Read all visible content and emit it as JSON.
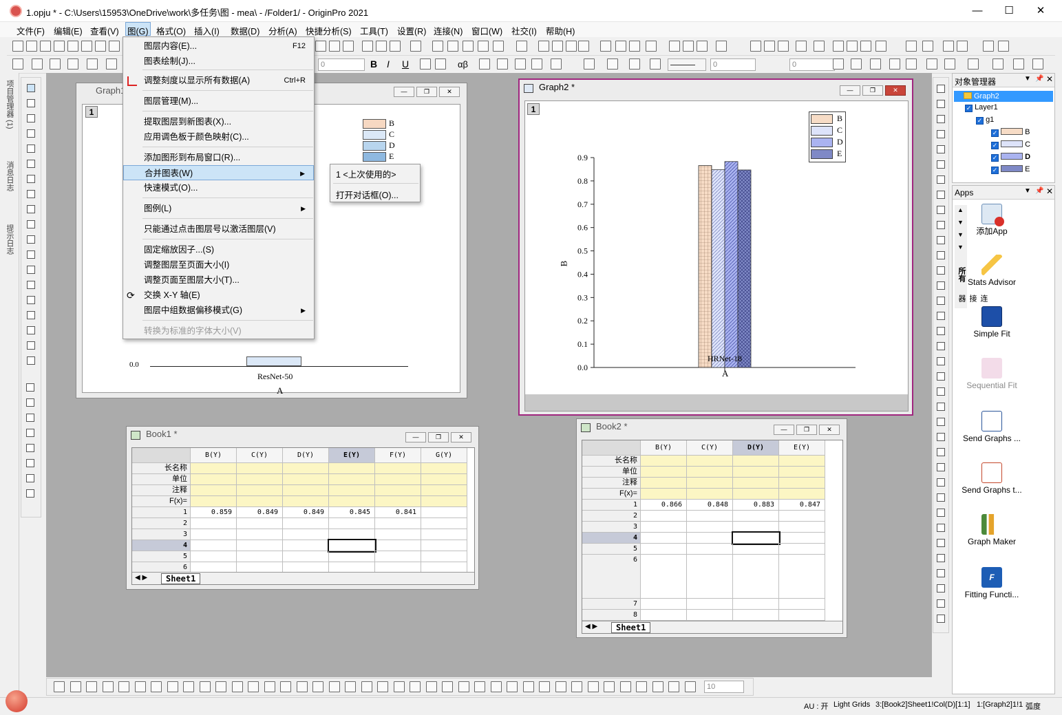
{
  "window": {
    "title": "1.opju * - C:\\Users\\15953\\OneDrive\\work\\多任务\\图 - mea\\ - /Folder1/ - OriginPro 2021",
    "minimize": "—",
    "maximize": "☐",
    "close": "✕"
  },
  "menubar": {
    "items": [
      "文件(F)",
      "编辑(E)",
      "查看(V)",
      "图(G)",
      "格式(O)",
      "插入(I)",
      "数据(D)",
      "分析(A)",
      "快捷分析(S)",
      "工具(T)",
      "设置(R)",
      "连接(N)",
      "窗口(W)",
      "社交(I)",
      "帮助(H)"
    ]
  },
  "toolbar": {
    "font_size_a": "0",
    "font_size_b": "0",
    "font_size_c": "0",
    "line_width": "0",
    "bold": "B",
    "italic": "I",
    "underline": "U",
    "alpha": "αβ",
    "zoom_value": "10"
  },
  "graph_menu": {
    "items": [
      {
        "label": "图层内容(E)...",
        "shortcut": "F12"
      },
      {
        "label": "图表绘制(J)...",
        "shortcut": ""
      },
      {
        "label": "调整刻度以显示所有数据(A)",
        "shortcut": "Ctrl+R"
      },
      {
        "label": "图层管理(M)...",
        "shortcut": ""
      },
      {
        "label": "提取图层到新图表(X)...",
        "shortcut": ""
      },
      {
        "label": "应用调色板于颜色映射(C)...",
        "shortcut": ""
      },
      {
        "label": "添加图形到布局窗口(R)...",
        "shortcut": ""
      },
      {
        "label": "合并图表(W)",
        "shortcut": ""
      },
      {
        "label": "快速模式(O)...",
        "shortcut": ""
      },
      {
        "label": "图例(L)",
        "shortcut": ""
      },
      {
        "label": "只能通过点击图层号以激活图层(V)",
        "shortcut": ""
      },
      {
        "label": "固定缩放因子...(S)",
        "shortcut": ""
      },
      {
        "label": "调整图层至页面大小(I)",
        "shortcut": ""
      },
      {
        "label": "调整页面至图层大小(T)...",
        "shortcut": ""
      },
      {
        "label": "交换 X-Y 轴(E)",
        "shortcut": ""
      },
      {
        "label": "图层中组数据偏移模式(G)",
        "shortcut": ""
      },
      {
        "label": "转换为标准的字体大小(V)",
        "shortcut": ""
      }
    ],
    "submenu": [
      "1 <上次使用的>",
      "打开对话框(O)..."
    ]
  },
  "graph1": {
    "title": "Graph1",
    "layer": "1",
    "legend": [
      "B",
      "C",
      "D",
      "E"
    ],
    "y_tick": "0.0",
    "y_label": "B",
    "x_category": "ResNet-50",
    "x_label": "A"
  },
  "graph2": {
    "title": "Graph2 *",
    "layer": "1",
    "legend": [
      "B",
      "C",
      "D",
      "E"
    ],
    "y_label": "B",
    "x_label": "A"
  },
  "chart_data": {
    "type": "bar",
    "categories": [
      "HRNet-18"
    ],
    "series": [
      {
        "name": "B",
        "values": [
          0.866
        ]
      },
      {
        "name": "C",
        "values": [
          0.848
        ]
      },
      {
        "name": "D",
        "values": [
          0.883
        ]
      },
      {
        "name": "E",
        "values": [
          0.847
        ]
      }
    ],
    "yticks": [
      "0.0",
      "0.1",
      "0.2",
      "0.3",
      "0.4",
      "0.5",
      "0.6",
      "0.7",
      "0.8",
      "0.9"
    ],
    "ylim": [
      0,
      0.9
    ],
    "xlabel": "A",
    "ylabel": "B",
    "legend": "top-right",
    "grid": false
  },
  "book1": {
    "title": "Book1 *",
    "columns": [
      "B(Y)",
      "C(Y)",
      "D(Y)",
      "E(Y)",
      "F(Y)",
      "G(Y)"
    ],
    "header_rows": [
      "长名称",
      "单位",
      "注释",
      "F(x)="
    ],
    "row_numbers": [
      "1",
      "2",
      "3",
      "4",
      "5",
      "6"
    ],
    "row1": [
      "0.859",
      "0.849",
      "0.849",
      "0.845",
      "0.841",
      ""
    ],
    "sheet": "Sheet1"
  },
  "book2": {
    "title": "Book2 *",
    "columns": [
      "B(Y)",
      "C(Y)",
      "D(Y)",
      "E(Y)"
    ],
    "header_rows": [
      "长名称",
      "单位",
      "注释",
      "F(x)="
    ],
    "row_numbers": [
      "1",
      "2",
      "3",
      "4",
      "5",
      "6",
      "7",
      "8"
    ],
    "row1": [
      "0.866",
      "0.848",
      "0.883",
      "0.847"
    ],
    "sheet": "Sheet1"
  },
  "left_dock": {
    "tabs": [
      "项目管理器 (1)",
      "消息日志",
      "提示日志"
    ]
  },
  "object_manager": {
    "title": "对象管理器",
    "root": "Graph2",
    "layer": "Layer1",
    "group": "g1",
    "plots": [
      "B",
      "C",
      "D",
      "E"
    ]
  },
  "apps": {
    "title": "Apps",
    "tabs": [
      "所有",
      "连接器"
    ],
    "items": [
      {
        "label": "添加App"
      },
      {
        "label": "Stats Advisor"
      },
      {
        "label": "Simple Fit"
      },
      {
        "label": "Sequential Fit"
      },
      {
        "label": "Send Graphs ..."
      },
      {
        "label": "Send Graphs t..."
      },
      {
        "label": "Graph Maker"
      },
      {
        "label": "Fitting Functi..."
      }
    ]
  },
  "statusbar": {
    "au": "AU : 开",
    "theme": "Light Grids",
    "cell": "3:[Book2]Sheet1!Col(D)[1:1]",
    "graph": "1:[Graph2]1!1",
    "unit": "弧度"
  }
}
